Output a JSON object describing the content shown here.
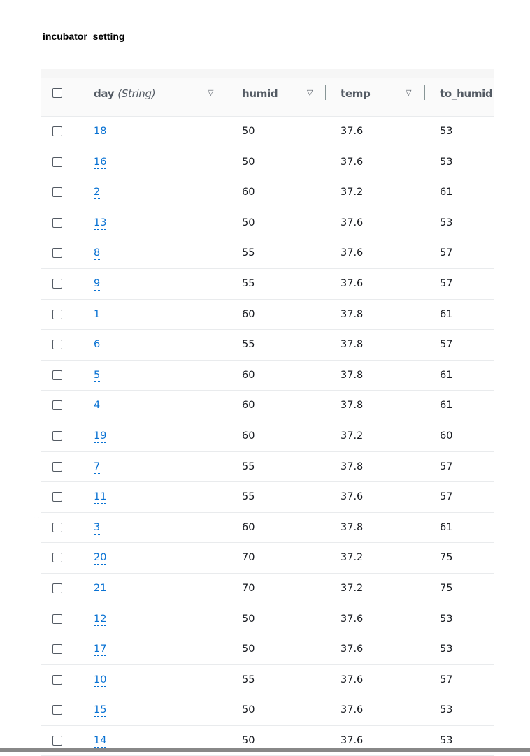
{
  "title": "incubator_setting",
  "columns": {
    "day": "day",
    "day_type": "(String)",
    "humid": "humid",
    "temp": "temp",
    "to_humid": "to_humid"
  },
  "rows": [
    {
      "day": "18",
      "humid": "50",
      "temp": "37.6",
      "to_humid": "53"
    },
    {
      "day": "16",
      "humid": "50",
      "temp": "37.6",
      "to_humid": "53"
    },
    {
      "day": "2",
      "humid": "60",
      "temp": "37.2",
      "to_humid": "61"
    },
    {
      "day": "13",
      "humid": "50",
      "temp": "37.6",
      "to_humid": "53"
    },
    {
      "day": "8",
      "humid": "55",
      "temp": "37.6",
      "to_humid": "57"
    },
    {
      "day": "9",
      "humid": "55",
      "temp": "37.6",
      "to_humid": "57"
    },
    {
      "day": "1",
      "humid": "60",
      "temp": "37.8",
      "to_humid": "61"
    },
    {
      "day": "6",
      "humid": "55",
      "temp": "37.8",
      "to_humid": "57"
    },
    {
      "day": "5",
      "humid": "60",
      "temp": "37.8",
      "to_humid": "61"
    },
    {
      "day": "4",
      "humid": "60",
      "temp": "37.8",
      "to_humid": "61"
    },
    {
      "day": "19",
      "humid": "60",
      "temp": "37.2",
      "to_humid": "60"
    },
    {
      "day": "7",
      "humid": "55",
      "temp": "37.8",
      "to_humid": "57"
    },
    {
      "day": "11",
      "humid": "55",
      "temp": "37.6",
      "to_humid": "57"
    },
    {
      "day": "3",
      "humid": "60",
      "temp": "37.8",
      "to_humid": "61"
    },
    {
      "day": "20",
      "humid": "70",
      "temp": "37.2",
      "to_humid": "75"
    },
    {
      "day": "21",
      "humid": "70",
      "temp": "37.2",
      "to_humid": "75"
    },
    {
      "day": "12",
      "humid": "50",
      "temp": "37.6",
      "to_humid": "53"
    },
    {
      "day": "17",
      "humid": "50",
      "temp": "37.6",
      "to_humid": "53"
    },
    {
      "day": "10",
      "humid": "55",
      "temp": "37.6",
      "to_humid": "57"
    },
    {
      "day": "15",
      "humid": "50",
      "temp": "37.6",
      "to_humid": "53"
    },
    {
      "day": "14",
      "humid": "50",
      "temp": "37.6",
      "to_humid": "53"
    }
  ],
  "icons": {
    "checkbox": "checkbox-icon",
    "sort": "sort-caret-down-icon"
  }
}
